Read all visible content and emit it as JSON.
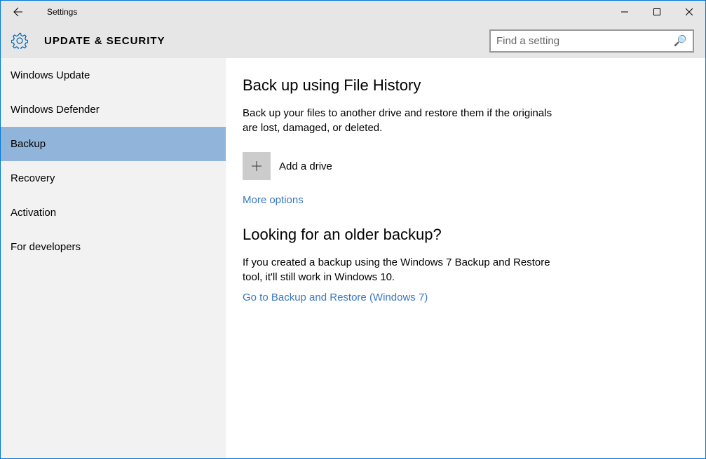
{
  "window": {
    "title": "Settings"
  },
  "header": {
    "title": "UPDATE & SECURITY"
  },
  "search": {
    "placeholder": "Find a setting"
  },
  "sidebar": {
    "items": [
      {
        "label": "Windows Update",
        "selected": false
      },
      {
        "label": "Windows Defender",
        "selected": false
      },
      {
        "label": "Backup",
        "selected": true
      },
      {
        "label": "Recovery",
        "selected": false
      },
      {
        "label": "Activation",
        "selected": false
      },
      {
        "label": "For developers",
        "selected": false
      }
    ]
  },
  "main": {
    "section1": {
      "title": "Back up using File History",
      "desc": "Back up your files to another drive and restore them if the originals are lost, damaged, or deleted.",
      "add_drive": "Add a drive",
      "more_options": "More options"
    },
    "section2": {
      "title": "Looking for an older backup?",
      "desc": "If you created a backup using the Windows 7 Backup and Restore tool, it'll still work in Windows 10.",
      "link": "Go to Backup and Restore (Windows 7)"
    }
  }
}
